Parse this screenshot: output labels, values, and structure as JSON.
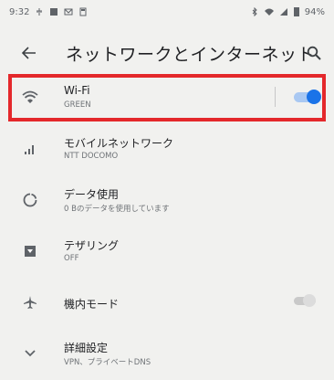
{
  "status_bar": {
    "time": "9:32",
    "battery": "94%",
    "left_icons": [
      "usb-icon",
      "image-icon",
      "mail-icon",
      "save-icon"
    ],
    "right_icons": [
      "bluetooth-icon",
      "wifi-icon",
      "signal-icon",
      "battery-icon"
    ]
  },
  "toolbar": {
    "title": "ネットワークとインターネット",
    "back_icon": "arrow-left-icon",
    "search_icon": "search-icon"
  },
  "highlight_color": "#e4282b",
  "accent_color": "#1a73e8",
  "items": [
    {
      "title": "Wi-Fi",
      "subtitle": "GREEN",
      "icon": "wifi-icon",
      "toggle": "on"
    },
    {
      "title": "モバイルネットワーク",
      "subtitle": "NTT DOCOMO",
      "icon": "signal-icon"
    },
    {
      "title": "データ使用",
      "subtitle": "0 Bのデータを使用しています",
      "icon": "data-usage-icon"
    },
    {
      "title": "テザリング",
      "subtitle": "OFF",
      "icon": "hotspot-icon"
    },
    {
      "title": "機内モード",
      "subtitle": "",
      "icon": "airplane-icon",
      "toggle": "off"
    },
    {
      "title": "詳細設定",
      "subtitle": "VPN、プライベートDNS",
      "icon": "chevron-down-icon"
    }
  ]
}
